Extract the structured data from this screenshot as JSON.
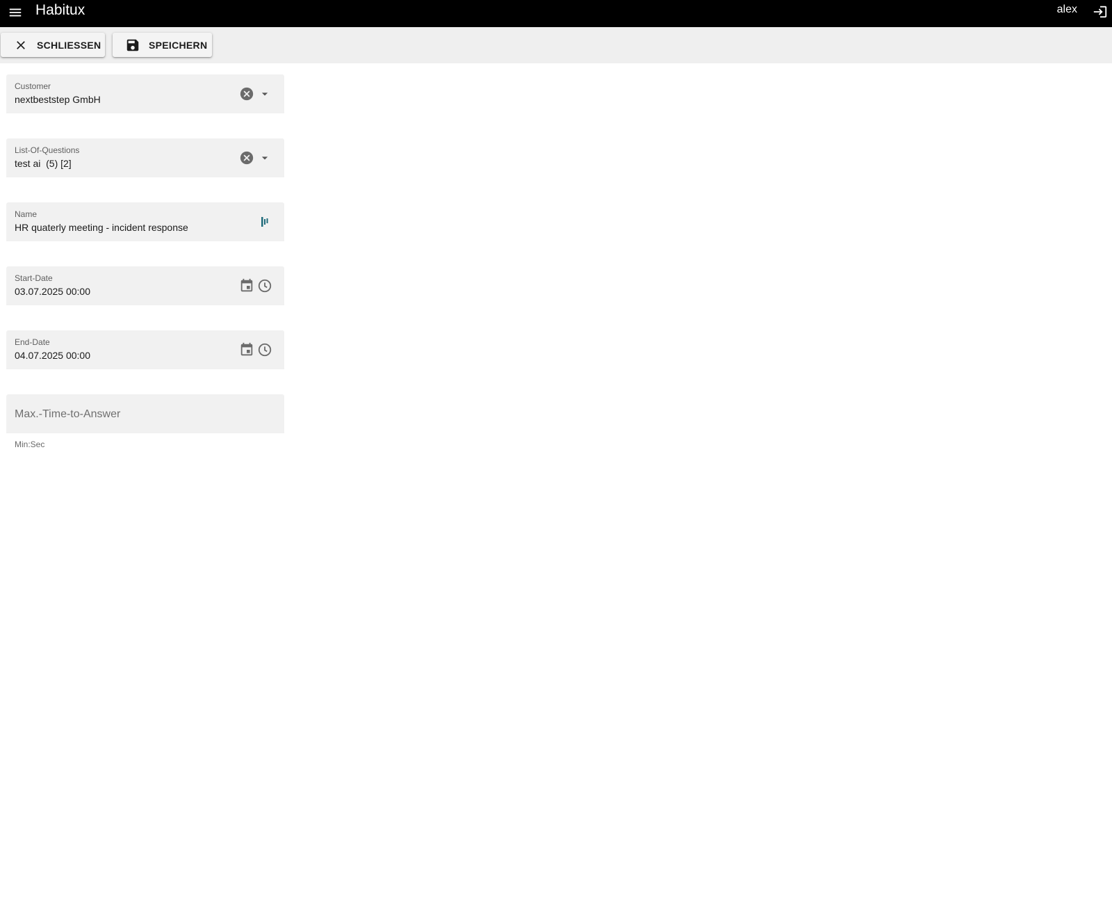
{
  "appbar": {
    "title": "Habitux",
    "user": "alex",
    "menu_icon": "menu-icon",
    "logout_icon": "logout-icon"
  },
  "toolbar": {
    "close_label": "SCHLIESSEN",
    "save_label": "SPEICHERN",
    "close_icon": "close-icon",
    "save_icon": "save-icon"
  },
  "form": {
    "customer": {
      "label": "Customer",
      "value": "nextbeststep GmbH"
    },
    "list_of_questions": {
      "label": "List-Of-Questions",
      "value": "test ai  (5) [2]"
    },
    "name": {
      "label": "Name",
      "value": "HR quaterly meeting - incident response"
    },
    "start_date": {
      "label": "Start-Date",
      "value": "03.07.2025 00:00"
    },
    "end_date": {
      "label": "End-Date",
      "value": "04.07.2025 00:00"
    },
    "max_time_to_answer": {
      "placeholder": "Max.-Time-to-Answer",
      "hint": "Min:Sec"
    }
  },
  "colors": {
    "appbar_bg": "#000000",
    "toolbar_bg": "#efefef",
    "field_bg": "#f1f1f1",
    "icon_grey": "#6b6b6b",
    "accent_teal": "#1e6b7a"
  }
}
